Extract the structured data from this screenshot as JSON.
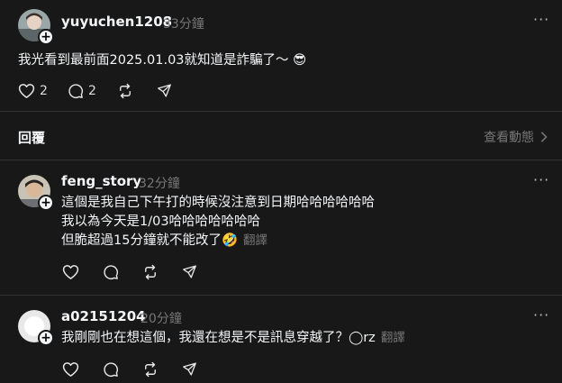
{
  "main_post": {
    "username": "yuyuchen1208",
    "timestamp": "33分鐘",
    "text": "我光看到最前面2025.01.03就知道是詐騙了～ 😎",
    "like_count": "2",
    "comment_count": "2"
  },
  "replies_header": {
    "title": "回覆",
    "view_activity": "查看動態"
  },
  "replies": [
    {
      "username": "feng_story",
      "timestamp": "32分鐘",
      "lines": [
        "這個是我自己下午打的時候沒注意到日期哈哈哈哈哈哈",
        "我以為今天是1/03哈哈哈哈哈哈哈",
        "但脆超過15分鐘就不能改了🤣"
      ],
      "translate": "翻譯"
    },
    {
      "username": "a02151204",
      "timestamp": "20分鐘",
      "lines": [
        "我剛剛也在想這個，我還在想是不是訊息穿越了？◯rz"
      ],
      "translate": "翻譯"
    }
  ],
  "icons": {
    "like": "heart-icon",
    "comment": "comment-icon",
    "repost": "repost-icon",
    "share": "send-icon",
    "more": "more-icon",
    "chevron": "chevron-right-icon",
    "follow": "plus-icon"
  },
  "colors": {
    "background": "#181818",
    "text": "#f3f5f7",
    "muted": "#777777",
    "divider": "#333333"
  }
}
